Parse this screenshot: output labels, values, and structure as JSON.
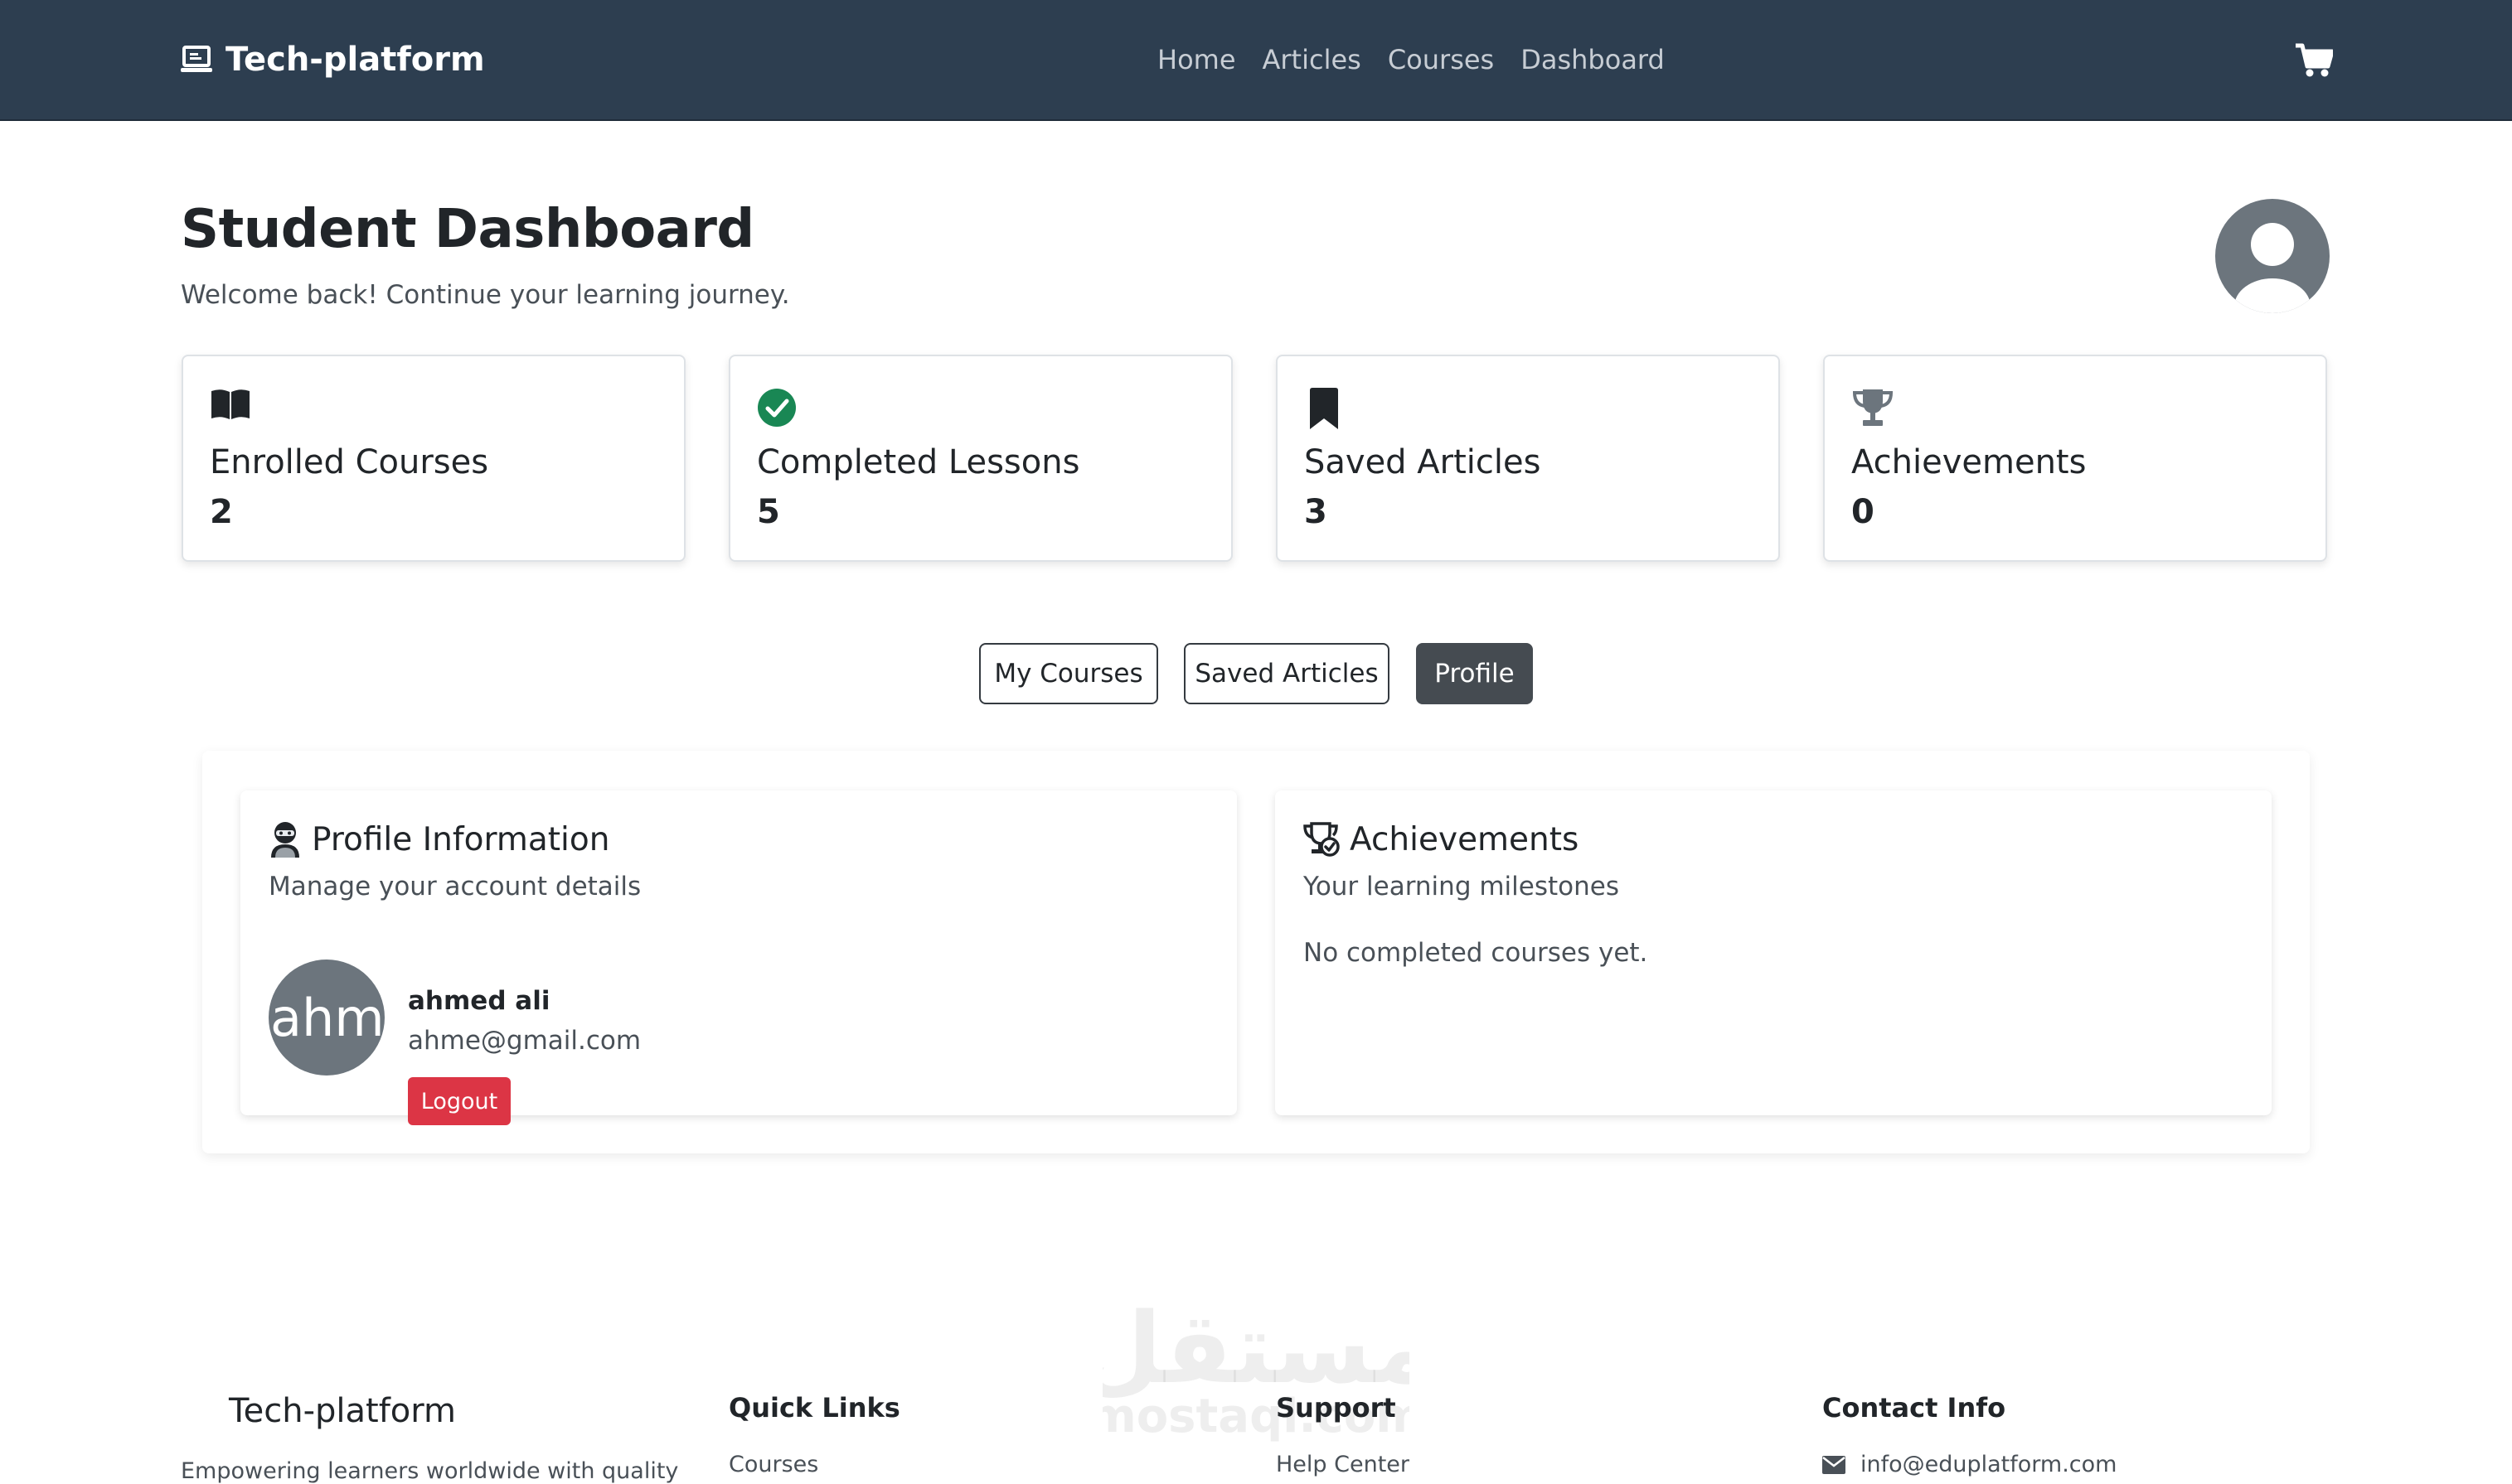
{
  "navbar": {
    "brand": "Tech-platform",
    "links": [
      "Home",
      "Articles",
      "Courses",
      "Dashboard"
    ],
    "brand_icon": "laptop-icon",
    "cart_icon": "shopping-cart-icon"
  },
  "header": {
    "title": "Student Dashboard",
    "subtitle": "Welcome back! Continue your learning journey.",
    "avatar_icon": "user-circle-icon"
  },
  "stats": [
    {
      "label": "Enrolled Courses",
      "value": "2",
      "icon": "book-open-icon",
      "color": "#212529"
    },
    {
      "label": "Completed Lessons",
      "value": "5",
      "icon": "check-circle-icon",
      "color": "#198754"
    },
    {
      "label": "Saved Articles",
      "value": "3",
      "icon": "bookmark-icon",
      "color": "#212529"
    },
    {
      "label": "Achievements",
      "value": "0",
      "icon": "trophy-icon",
      "color": "#6c757d"
    }
  ],
  "tabs": {
    "items": [
      "My Courses",
      "Saved Articles",
      "Profile"
    ],
    "active": "Profile"
  },
  "profile": {
    "title": "Profile Information",
    "subtitle": "Manage your account details",
    "avatar_text": "ahmed",
    "name": "ahmed ali",
    "email": "ahme@gmail.com",
    "logout_label": "Logout"
  },
  "achievements_card": {
    "title": "Achievements",
    "subtitle": "Your learning milestones",
    "empty_text": "No completed courses yet."
  },
  "footer": {
    "brand": "Tech-platform",
    "brand_text_partial": "Empowering learners worldwide with quality",
    "quick_links_heading": "Quick Links",
    "quick_links_first": "Courses",
    "support_heading": "Support",
    "support_first": "Help Center",
    "contact_heading": "Contact Info",
    "contact_email": "info@eduplatform.com"
  },
  "watermark": {
    "text_arabic": "مستقل",
    "text_latin": "mostaql.com"
  },
  "colors": {
    "navbar_bg": "#2d3e50",
    "danger": "#dc3545",
    "success": "#198754",
    "tab_active_bg": "#454b51"
  }
}
